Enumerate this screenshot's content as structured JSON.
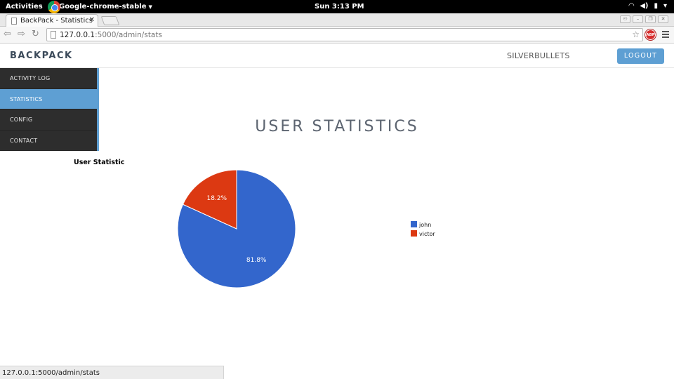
{
  "system_bar": {
    "activities": "Activities",
    "app_name": "Google-chrome-stable",
    "clock": "Sun  3:13 PM"
  },
  "browser": {
    "tab_title": "BackPack - Statistics",
    "url_host": "127.0.0.1",
    "url_path": ":5000/admin/stats",
    "status_url": "127.0.0.1:5000/admin/stats",
    "adblock_label": "ABP"
  },
  "header": {
    "brand": "BACKPACK",
    "username": "SILVERBULLETS",
    "logout_label": "LOGOUT"
  },
  "sidebar": {
    "items": [
      {
        "label": "ACTIVITY LOG",
        "active": false
      },
      {
        "label": "STATISTICS",
        "active": true
      },
      {
        "label": "CONFIG",
        "active": false
      },
      {
        "label": "CONTACT",
        "active": false
      }
    ]
  },
  "main": {
    "heading": "USER STATISTICS"
  },
  "chart_data": {
    "type": "pie",
    "title": "User Statistic",
    "labels": [
      "john",
      "victor"
    ],
    "values": [
      81.8,
      18.2
    ],
    "value_labels": [
      "81.8%",
      "18.2%"
    ],
    "colors": [
      "#3366cc",
      "#dc3912"
    ],
    "legend": "right"
  }
}
